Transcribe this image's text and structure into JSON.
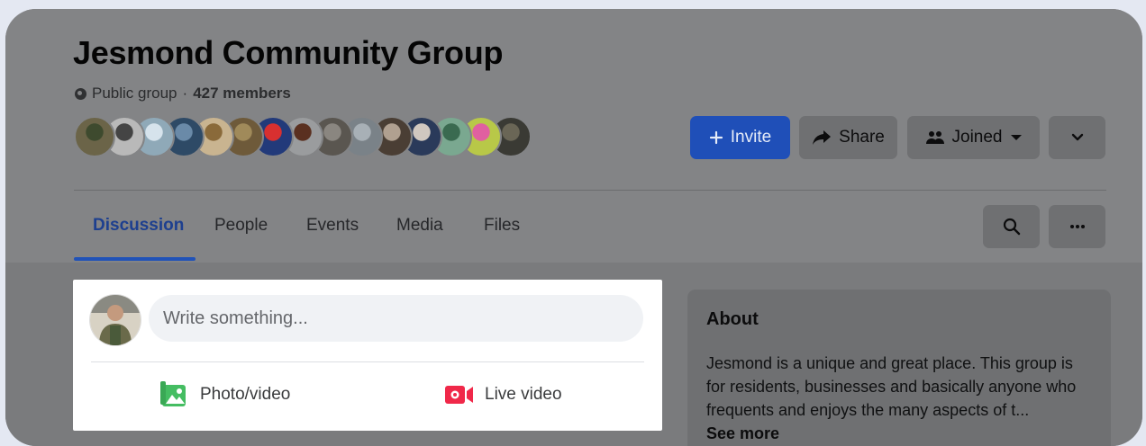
{
  "group": {
    "title": "Jesmond Community Group",
    "privacy": "Public group",
    "separator": "·",
    "members": "427 members"
  },
  "member_avatars": [
    {
      "color": "#6b6448",
      "accent": "#3e4a2e"
    },
    {
      "color": "#b9b9b9",
      "accent": "#444444"
    },
    {
      "color": "#8fa9b8",
      "accent": "#d6e3ec"
    },
    {
      "color": "#2e4a66",
      "accent": "#6a8aa8"
    },
    {
      "color": "#c9b490",
      "accent": "#8a6a3a"
    },
    {
      "color": "#6e5a3a",
      "accent": "#a08a5a"
    },
    {
      "color": "#223a7a",
      "accent": "#d83030"
    },
    {
      "color": "#9a9c9e",
      "accent": "#5a3020"
    },
    {
      "color": "#5a5650",
      "accent": "#8a8680"
    },
    {
      "color": "#7a8288",
      "accent": "#a8b0b6"
    },
    {
      "color": "#4a3e34",
      "accent": "#b0a090"
    },
    {
      "color": "#2a3a5a",
      "accent": "#d0c8c0"
    },
    {
      "color": "#7aa890",
      "accent": "#3a6a50"
    },
    {
      "color": "#b8c848",
      "accent": "#e060a0"
    },
    {
      "color": "#3a3a34",
      "accent": "#6a6656"
    }
  ],
  "actions": {
    "invite": "Invite",
    "share": "Share",
    "joined": "Joined"
  },
  "tabs": [
    {
      "label": "Discussion",
      "active": true
    },
    {
      "label": "People",
      "active": false
    },
    {
      "label": "Events",
      "active": false
    },
    {
      "label": "Media",
      "active": false
    },
    {
      "label": "Files",
      "active": false
    }
  ],
  "composer": {
    "placeholder": "Write something...",
    "photo_video": "Photo/video",
    "live_video": "Live video"
  },
  "about": {
    "title": "About",
    "description": "Jesmond is a unique and great place. This group is for residents, businesses and basically anyone who frequents and enjoys the many aspects of t...",
    "see_more": "See more"
  },
  "colors": {
    "accent_blue": "#1877f2",
    "photo_green": "#45bd62",
    "live_red": "#f02849"
  },
  "icons": {
    "privacy": "globe-icon",
    "invite": "plus-icon",
    "share": "share-arrow-icon",
    "joined": "people-icon",
    "joined_menu": "caret-down-icon",
    "more": "chevron-down-icon",
    "search": "search-icon",
    "options": "ellipsis-icon",
    "photo": "photo-icon",
    "live": "video-camera-icon"
  }
}
